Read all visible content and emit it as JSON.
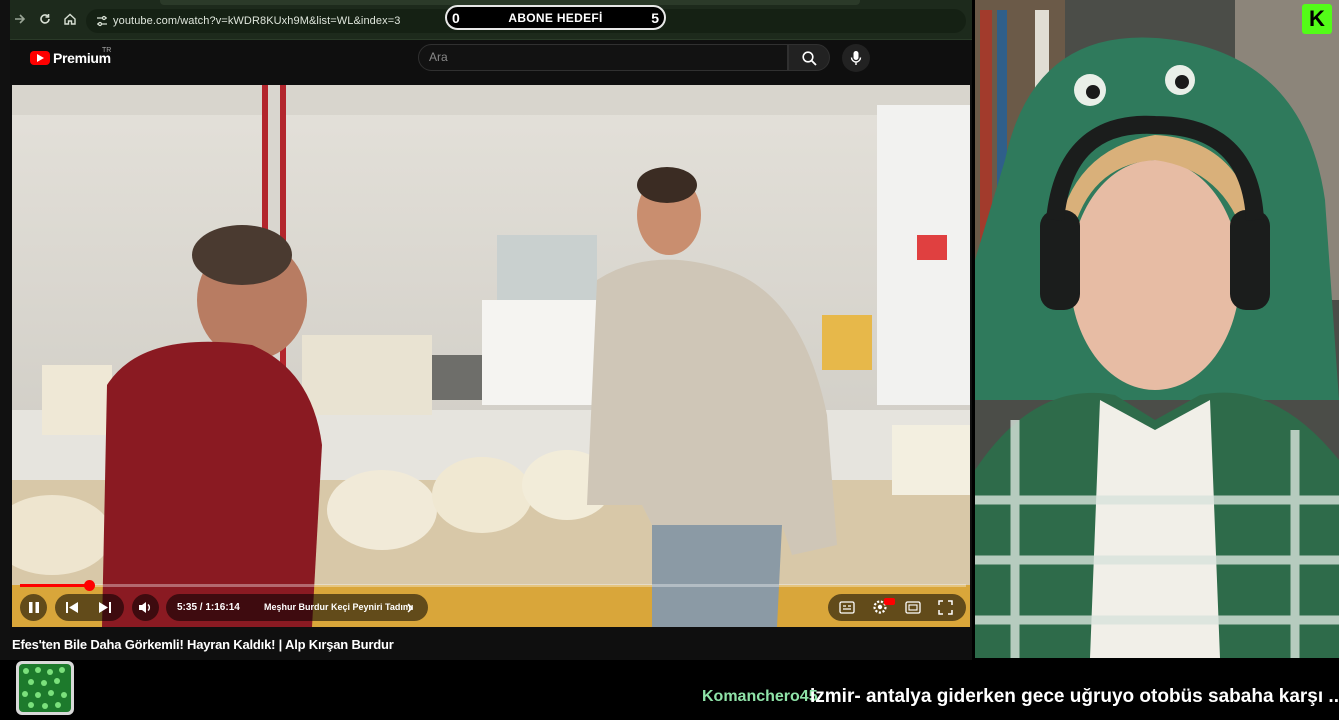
{
  "browser": {
    "url": "youtube.com/watch?v=kWDR8KUxh9M&list=WL&index=3",
    "icons": [
      "forward-icon",
      "reload-icon",
      "home-icon",
      "site-settings-icon"
    ]
  },
  "goal": {
    "left_value": "0",
    "title": "ABONE HEDEFİ",
    "right_value": "5"
  },
  "youtube": {
    "brand": "Premium",
    "region": "TR",
    "search_placeholder": "Ara",
    "accent": "#ff0000"
  },
  "player": {
    "time": "5:35 / 1:16:14",
    "chapter": "Meşhur Burdur Keçi Peyniri Tadımı",
    "progress": 0.073,
    "title": "Efes'ten Bile Daha Görkemli! Hayran Kaldık! | Alp Kırşan Burdur"
  },
  "overlay": {
    "kick_letter": "K",
    "kick_color": "#53fc18"
  },
  "chat": {
    "username": "Komanchero45",
    "message": "izmir- antalya giderken gece uğruyo otobüs sabaha karşı .."
  }
}
